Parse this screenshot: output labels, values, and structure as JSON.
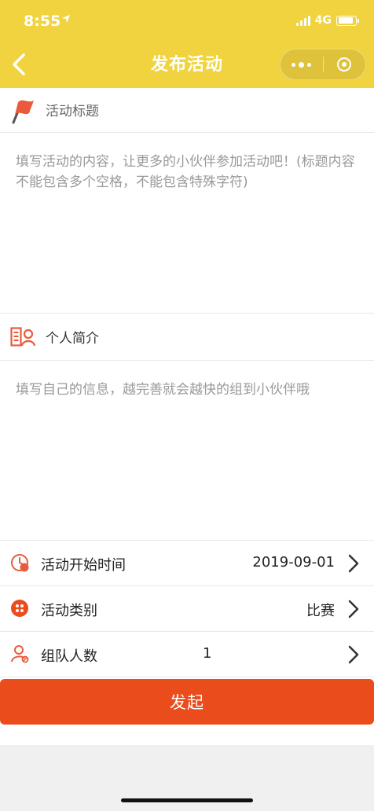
{
  "status": {
    "time": "8:55",
    "network": "4G"
  },
  "nav": {
    "title": "发布活动"
  },
  "form": {
    "title_label": "活动标题",
    "description_placeholder": "填写活动的内容，让更多的小伙伴参加活动吧！(标题内容不能包含多个空格，不能包含特殊字符)",
    "intro_label": "个人简介",
    "intro_placeholder": "填写自己的信息，越完善就会越快的组到小伙伴哦",
    "start_time": {
      "label": "活动开始时间",
      "value": "2019-09-01"
    },
    "category": {
      "label": "活动类别",
      "value": "比赛"
    },
    "team_size": {
      "label": "组队人数",
      "value": "1"
    }
  },
  "actions": {
    "submit": "发起"
  },
  "colors": {
    "header": "#f1d340",
    "accent": "#ea4c1c"
  },
  "icons": [
    "location-arrow-icon",
    "signal-icon",
    "battery-icon",
    "back-arrow-icon",
    "more-icon",
    "close-capsule-icon",
    "flag-icon",
    "profile-card-icon",
    "clock-icon",
    "category-icon",
    "person-icon",
    "chevron-right-icon"
  ]
}
